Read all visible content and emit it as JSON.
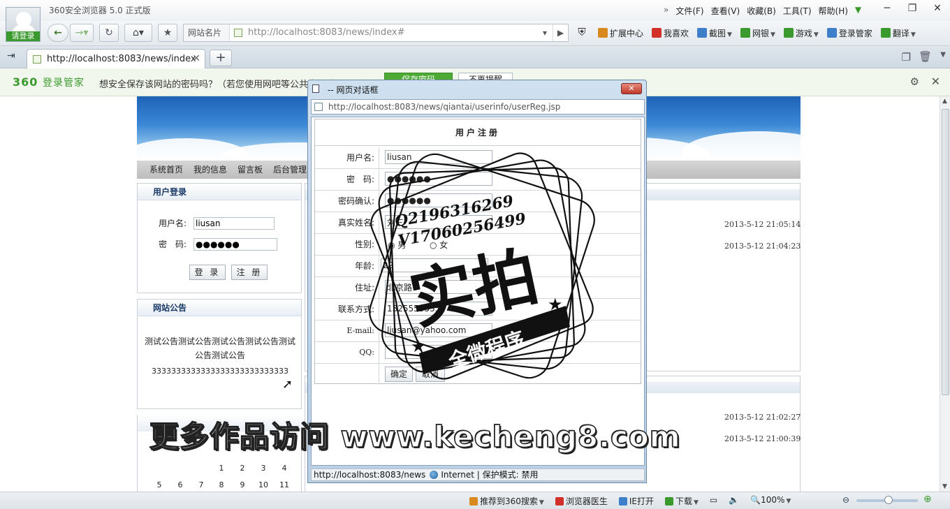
{
  "browser": {
    "app_title": "360安全浏览器 5.0 正式版",
    "login_label": "请登录",
    "menu": [
      "文件(F)",
      "查看(V)",
      "收藏(B)",
      "工具(T)",
      "帮助(H)"
    ],
    "menu_arrow": "»",
    "window_controls": [
      "─",
      "❐",
      "✕"
    ]
  },
  "toolbar": {
    "site_card": "网站名片",
    "url": "http://localhost:8083/news/index#",
    "extensions": [
      {
        "label": "扩展中心",
        "icon": "puzzle-icon",
        "color": "#d98a1e"
      },
      {
        "label": "我喜欢",
        "icon": "heart-icon",
        "color": "#d2312a"
      },
      {
        "label": "截图",
        "icon": "scissors-icon",
        "color": "#3f7ec8"
      },
      {
        "label": "网银",
        "icon": "bank-icon",
        "color": "#3a9a2e"
      },
      {
        "label": "游戏",
        "icon": "gamepad-icon",
        "color": "#3a9a2e"
      },
      {
        "label": "登录管家",
        "icon": "key-icon",
        "color": "#3f7ec8"
      },
      {
        "label": "翻译",
        "icon": "translate-icon",
        "color": "#3a9a2e"
      }
    ]
  },
  "tabs": {
    "active_title": "http://localhost:8083/news/index",
    "close": "✕",
    "new_tab": "+"
  },
  "password_bar": {
    "logo_number": "360",
    "logo_text": "登录管家",
    "question": "想安全保存该网站的密码吗？（若您使用网吧等公共电脑请不要保存）",
    "save_label": "保存密码",
    "never_label": "不再提醒"
  },
  "site": {
    "nav": [
      "系统首页",
      "我的信息",
      "留言板",
      "后台管理"
    ],
    "login": {
      "title": "用户登录",
      "username_label": "用户名:",
      "username_value": "liusan",
      "password_label": "密　码:",
      "password_value": "●●●●●●",
      "login_button": "登 录",
      "register_button": "注 册"
    },
    "notice": {
      "title": "网站公告",
      "text": "测试公告测试公告测试公告测试公告测试公告测试公告",
      "number": "3333333333333333333333333333"
    },
    "calendar": {
      "row1": [
        "",
        "",
        "",
        "1",
        "2",
        "3",
        "4"
      ],
      "row2": [
        "5",
        "6",
        "7",
        "8",
        "9",
        "10",
        "11"
      ]
    },
    "dates": [
      "2013-5-12 21:05:14",
      "2013-5-12 21:04:23",
      "2013-5-12 21:02:27",
      "2013-5-12 21:00:39"
    ]
  },
  "dialog": {
    "title": "-- 网页对话框",
    "close": "✕",
    "url": "http://localhost:8083/news/qiantai/userinfo/userReg.jsp",
    "form_title": "用户注册",
    "fields": {
      "username": {
        "label": "用户名:",
        "value": "liusan"
      },
      "password": {
        "label": "密　码:",
        "value": "●●●●●●"
      },
      "password_confirm": {
        "label": "密码确认:",
        "value": "●●●●●●"
      },
      "realname": {
        "label": "真实姓名:",
        "value": "刘三"
      },
      "gender": {
        "label": "性别:",
        "male": "男",
        "female": "女"
      },
      "age": {
        "label": "年龄:",
        "value": "22"
      },
      "address": {
        "label": "住址:",
        "value": "北京路"
      },
      "contact": {
        "label": "联系方式:",
        "value": "13255555555"
      },
      "email": {
        "label": "E-mail:",
        "value": "liusan@yahoo.com"
      },
      "qq": {
        "label": "QQ:",
        "value": ""
      }
    },
    "confirm_button": "确定",
    "cancel_button": "取消",
    "status_url": "http://localhost:8083/news",
    "status_zone": "Internet | 保护模式: 禁用"
  },
  "watermark": {
    "line1": "Q2196316269",
    "line2": "V17060256499",
    "big": "实拍",
    "ribbon": "全微程序",
    "overlay": "更多作品访问 www.kecheng8.com"
  },
  "statusbar": {
    "items": [
      {
        "label": "推荐到360搜索",
        "icon": "thumb-icon",
        "color": "#d98a1e"
      },
      {
        "label": "浏览器医生",
        "icon": "doctor-icon",
        "color": "#d2312a"
      },
      {
        "label": "IE打开",
        "icon": "ie-icon",
        "color": "#3f7ec8"
      },
      {
        "label": "下载",
        "icon": "download-icon",
        "color": "#3a9a2e"
      }
    ],
    "zoom": "100%",
    "zoom_level_percent": 100
  }
}
